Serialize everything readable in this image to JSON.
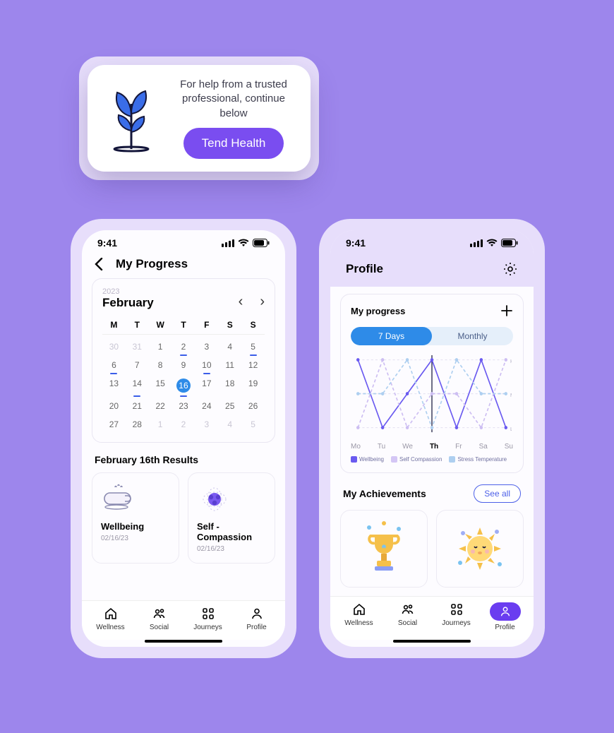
{
  "banner": {
    "text": "For help from a trusted professional,  continue below",
    "cta": "Tend Health"
  },
  "status": {
    "time": "9:41"
  },
  "progress_page": {
    "title": "My Progress",
    "year": "2023",
    "month": "February",
    "weekdays": [
      "M",
      "T",
      "W",
      "T",
      "F",
      "S",
      "S"
    ],
    "days": [
      {
        "n": "30",
        "off": true
      },
      {
        "n": "31",
        "off": true
      },
      {
        "n": "1"
      },
      {
        "n": "2",
        "mark": true
      },
      {
        "n": "3"
      },
      {
        "n": "4"
      },
      {
        "n": "5",
        "mark": true
      },
      {
        "n": "6",
        "mark": true
      },
      {
        "n": "7"
      },
      {
        "n": "8"
      },
      {
        "n": "9"
      },
      {
        "n": "10",
        "mark": true
      },
      {
        "n": "11"
      },
      {
        "n": "12"
      },
      {
        "n": "13"
      },
      {
        "n": "14",
        "mark": true
      },
      {
        "n": "15"
      },
      {
        "n": "16",
        "sel": true,
        "mark": true
      },
      {
        "n": "17"
      },
      {
        "n": "18"
      },
      {
        "n": "19"
      },
      {
        "n": "20"
      },
      {
        "n": "21"
      },
      {
        "n": "22"
      },
      {
        "n": "23"
      },
      {
        "n": "24"
      },
      {
        "n": "25"
      },
      {
        "n": "26"
      },
      {
        "n": "27"
      },
      {
        "n": "28"
      },
      {
        "n": "1",
        "off": true
      },
      {
        "n": "2",
        "off": true
      },
      {
        "n": "3",
        "off": true
      },
      {
        "n": "4",
        "off": true
      },
      {
        "n": "5",
        "off": true
      }
    ],
    "results_title": "February 16th  Results",
    "results": [
      {
        "title": "Wellbeing",
        "date": "02/16/23"
      },
      {
        "title": "Self - Compassion",
        "date": "02/16/23"
      }
    ]
  },
  "profile_page": {
    "title": "Profile",
    "progress_title": "My progress",
    "tabs": [
      "7 Days",
      "Monthly"
    ],
    "chart_days": [
      "Mo",
      "Tu",
      "We",
      "Th",
      "Fr",
      "Sa",
      "Su"
    ],
    "chart_y_labels": [
      "H",
      "M",
      "L"
    ],
    "legend": [
      {
        "label": "Wellbeing",
        "color": "#6a5af0"
      },
      {
        "label": "Self Compassion",
        "color": "#d4c6f5"
      },
      {
        "label": "Stress Temperature",
        "color": "#aecff0"
      }
    ],
    "ach_title": "My Achievements",
    "see_all": "See all"
  },
  "tabs": {
    "wellness": "Wellness",
    "social": "Social",
    "journeys": "Journeys",
    "profile": "Profile"
  },
  "chart_data": {
    "type": "line",
    "x": [
      "Mo",
      "Tu",
      "We",
      "Th",
      "Fr",
      "Sa",
      "Su"
    ],
    "y_scale": {
      "L": 0,
      "M": 1,
      "H": 2
    },
    "series": [
      {
        "name": "Wellbeing",
        "color": "#6a5af0",
        "values": [
          2,
          0,
          1,
          2,
          0,
          2,
          0
        ]
      },
      {
        "name": "Self Compassion",
        "color": "#cdbef2",
        "dashed": true,
        "values": [
          0,
          2,
          0,
          1,
          1,
          0,
          2
        ]
      },
      {
        "name": "Stress Temperature",
        "color": "#aecff0",
        "dashed": true,
        "values": [
          1,
          1,
          2,
          0,
          2,
          1,
          1
        ]
      }
    ],
    "highlight_x": "Th",
    "ylabels": [
      "H",
      "M",
      "L"
    ]
  }
}
